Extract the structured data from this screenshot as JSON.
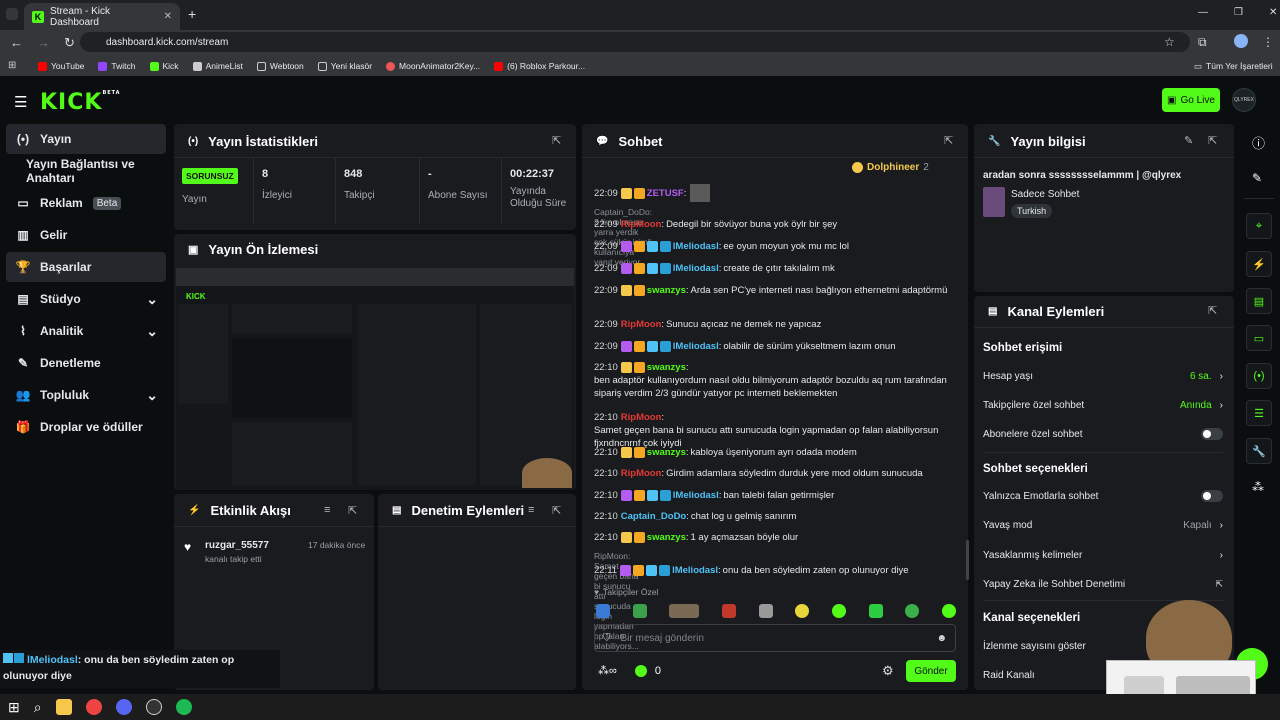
{
  "browser": {
    "tab_title": "Stream - Kick Dashboard",
    "url": "dashboard.kick.com/stream",
    "bookmarks": [
      "YouTube",
      "Twitch",
      "Kick",
      "AnimeList",
      "Webtoon",
      "Yeni klasör",
      "MoonAnimator2Key...",
      "(6) Roblox Parkour..."
    ],
    "bookmarks_right": "Tüm Yer İşaretleri"
  },
  "app": {
    "logo": "KICK",
    "logo_sup": "BETA",
    "go_live": "Go Live",
    "avatar_text": "QLYREX"
  },
  "nav": [
    {
      "label": "Yayın",
      "icon": "(•)"
    },
    {
      "label": "Yayın Bağlantısı ve Anahtarı",
      "icon": ""
    },
    {
      "label": "Reklam",
      "icon": "▭",
      "badge": "Beta"
    },
    {
      "label": "Gelir",
      "icon": "▥"
    },
    {
      "label": "Başarılar",
      "icon": "🏆"
    },
    {
      "label": "Stüdyo",
      "icon": "▤"
    },
    {
      "label": "Analitik",
      "icon": "⌇"
    },
    {
      "label": "Denetleme",
      "icon": "✎"
    },
    {
      "label": "Topluluk",
      "icon": "👥"
    },
    {
      "label": "Droplar ve ödüller",
      "icon": "🎁"
    }
  ],
  "stats": {
    "title": "Yayın İstatistikleri",
    "status": "SORUNSUZ",
    "status_label": "Yayın",
    "viewers": "8",
    "viewers_label": "İzleyici",
    "followers": "848",
    "followers_label": "Takipçi",
    "subs": "-",
    "subs_label": "Abone Sayısı",
    "uptime": "00:22:37",
    "uptime_label": "Yayında Olduğu Süre"
  },
  "preview": {
    "title": "Yayın Ön İzlemesi"
  },
  "activity": {
    "title": "Etkinlik Akışı",
    "user": "ruzgar_55577",
    "time": "17 dakika önce",
    "desc": "kanalı takip etti"
  },
  "modlog": {
    "title": "Denetim Eylemleri"
  },
  "chat": {
    "title": "Sohbet",
    "pinned_user": "Dolphineer",
    "pinned_count": "2",
    "messages": [
      {
        "time": "22:09",
        "user": "ZETUSF",
        "color": "#b45cf0",
        "text": ""
      },
      {
        "reply": "Captain_DoDo: 2 lira olmasa yarra yerdik çok şükür isimli kullanıcıya yanıt veriyor"
      },
      {
        "time": "22:09",
        "user": "RipMoon",
        "color": "#e53935",
        "text": "Dedegil bir sövüyor buna yok öylr bir şey"
      },
      {
        "time": "22:09",
        "user": "lMeliodasl",
        "color": "#4fc3f7",
        "text": "ee oyun moyun yok mu mc lol"
      },
      {
        "time": "22:09",
        "user": "lMeliodasl",
        "color": "#4fc3f7",
        "text": "create de çıtır takılalım mk"
      },
      {
        "time": "22:09",
        "user": "swanzys",
        "color": "#53fc18",
        "text": "Arda sen PC'ye interneti nası bağlıyon ethernetmi adaptörmü"
      },
      {
        "time": "22:09",
        "user": "RipMoon",
        "color": "#e53935",
        "text": "Sunucu açıcaz ne demek ne yapıcaz"
      },
      {
        "time": "22:09",
        "user": "lMeliodasl",
        "color": "#4fc3f7",
        "text": "olabilir de sürüm yükseltmem lazım onun"
      },
      {
        "time": "22:10",
        "user": "swanzys",
        "color": "#53fc18",
        "text": "ben adaptör kullanıyordum nasıl oldu bilmiyorum adaptör bozuldu aq rum tarafından sipariş verdim 2/3 gündür yatıyor pc interneti beklemekten"
      },
      {
        "time": "22:10",
        "user": "RipMoon",
        "color": "#e53935",
        "text": "Samet geçen bana bi sunucu attı sunucuda login yapmadan op falan alabiliyorsun fjxndncnrnf çok iyiydi"
      },
      {
        "time": "22:10",
        "user": "swanzys",
        "color": "#53fc18",
        "text": "kabloya üşeniyorum ayrı odada modem"
      },
      {
        "time": "22:10",
        "user": "RipMoon",
        "color": "#e53935",
        "text": "Girdim adamlara söyledim durduk yere mod oldum sunucuda"
      },
      {
        "time": "22:10",
        "user": "lMeliodasl",
        "color": "#4fc3f7",
        "text": "ban talebi falan getirmişler"
      },
      {
        "time": "22:10",
        "user": "Captain_DoDo",
        "color": "#4fc3f7",
        "text": "chat log u gelmiş sanırım"
      },
      {
        "time": "22:10",
        "user": "swanzys",
        "color": "#53fc18",
        "text": "1 ay açmazsan böyle olur"
      },
      {
        "reply": "RipMoon: Samet geçen bana bi sunucu attı sunucuda login yapmadan op falan alabiliyors..."
      },
      {
        "time": "22:11",
        "user": "lMeliodasl",
        "color": "#4fc3f7",
        "text": "onu da ben söyledim zaten op olunuyor diye"
      }
    ],
    "followers_only": "Takipçiler Özel",
    "input_placeholder": "Bir mesaj gönderin",
    "count": "0",
    "send": "Gönder"
  },
  "streaminfo": {
    "title": "Yayın bilgisi",
    "stream_title": "aradan sonra sssssssselammm | @qlyrex",
    "category": "Sadece Sohbet",
    "tag": "Turkish"
  },
  "channel": {
    "title": "Kanal Eylemleri",
    "chat_access": "Sohbet erişimi",
    "account_age": "Hesap yaşı",
    "account_age_val": "6 sa.",
    "followers_chat": "Takipçilere özel sohbet",
    "followers_chat_val": "Anında",
    "subs_chat": "Abonelere özel sohbet",
    "chat_options": "Sohbet seçenekleri",
    "emote_only": "Yalnızca Emotlarla sohbet",
    "slow_mode": "Yavaş mod",
    "slow_mode_val": "Kapalı",
    "banned_words": "Yasaklanmış kelimeler",
    "ai_mod": "Yapay Zeka ile Sohbet Denetimi",
    "channel_options": "Kanal seçenekleri",
    "show_views": "İzlenme sayısını göster",
    "raid": "Raid Kanalı"
  },
  "overlay": {
    "user": "lMeliodasl",
    "text": ": onu da ben söyledim zaten op olunuyor diye"
  },
  "colors": {
    "accent": "#53fc18",
    "bg": "#0b0e0f",
    "panel": "#191b1f"
  }
}
